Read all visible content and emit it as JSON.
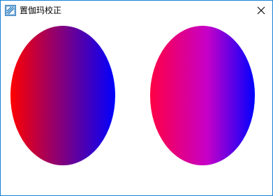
{
  "window": {
    "title": "置伽玛校正",
    "icon": "app-icon",
    "close_icon": "close-icon"
  },
  "canvas": {
    "ellipses": [
      {
        "name": "left-gradient-ellipse",
        "from_color": "#ff0000",
        "to_color": "#0000ff"
      },
      {
        "name": "right-gradient-ellipse",
        "from_color": "#ff0044",
        "to_color": "#0000ff"
      }
    ]
  }
}
